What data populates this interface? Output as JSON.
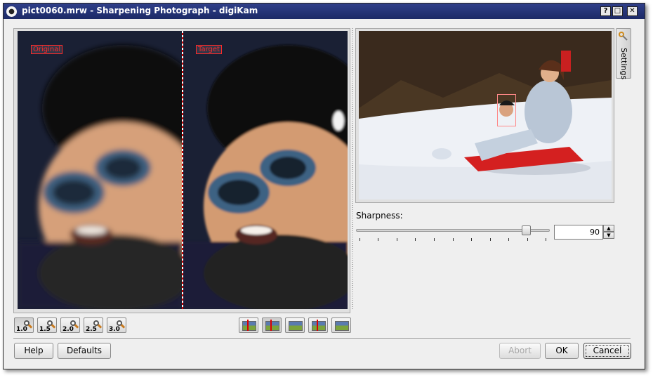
{
  "window": {
    "title": "pict0060.mrw - Sharpening Photograph - digiKam",
    "title_icon": "digikam-app-icon",
    "controls": [
      "?",
      "□",
      "✕"
    ]
  },
  "preview": {
    "left_label": "Original",
    "right_label": "Target"
  },
  "zoom_buttons": [
    {
      "label": "1.0",
      "active": true
    },
    {
      "label": "1.5",
      "active": false
    },
    {
      "label": "2.0",
      "active": false
    },
    {
      "label": "2.5",
      "active": false
    },
    {
      "label": "3.0",
      "active": false
    }
  ],
  "view_mode_buttons": [
    {
      "icon": "original-target-split-vertical-icon",
      "active": false
    },
    {
      "icon": "split-vertical-icon",
      "active": true
    },
    {
      "icon": "split-horizontal-icon",
      "active": false
    },
    {
      "icon": "split-duplicate-icon",
      "active": false
    },
    {
      "icon": "target-only-icon",
      "active": false
    }
  ],
  "settings_tab": {
    "label": "Settings",
    "icon": "wrench-icon"
  },
  "sharpness": {
    "label": "Sharpness:",
    "value": "90",
    "slider_fraction": 0.9
  },
  "buttons": {
    "help": "Help",
    "defaults": "Defaults",
    "abort": "Abort",
    "ok": "OK",
    "cancel": "Cancel"
  },
  "colors": {
    "titlebar": "#23306f",
    "label_red": "#ff2a2a"
  }
}
